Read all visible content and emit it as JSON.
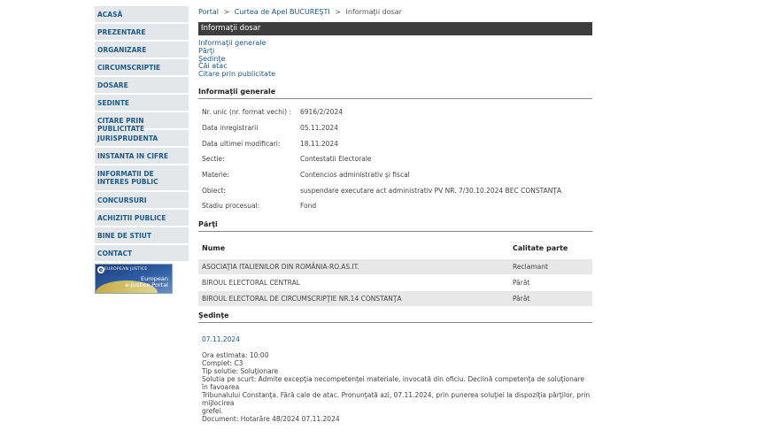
{
  "sidebar": {
    "items": [
      {
        "label": "ACASĂ"
      },
      {
        "label": "PREZENTARE"
      },
      {
        "label": "ORGANIZARE"
      },
      {
        "label": "CIRCUMSCRIPTIE"
      },
      {
        "label": "DOSARE"
      },
      {
        "label": "SEDINTE"
      },
      {
        "label": "CITARE PRIN PUBLICITATE"
      },
      {
        "label": "JURISPRUDENTA"
      },
      {
        "label": "INSTANTA IN CIFRE"
      },
      {
        "label": "INFORMATII DE INTERES PUBLIC"
      },
      {
        "label": "CONCURSURI"
      },
      {
        "label": "ACHIZITII PUBLICE"
      },
      {
        "label": "BINE DE STIUT"
      },
      {
        "label": "CONTACT"
      }
    ],
    "ejustice": {
      "top": "EUROPEAN JUSTICE",
      "line1": "European",
      "line2": "e-Justice Portal"
    }
  },
  "breadcrumb": {
    "portal": "Portal",
    "court": "Curtea de Apel BUCUREŞTI",
    "current": "Informaţii dosar",
    "sep": ">"
  },
  "title": "Informaţii dosar",
  "toc": [
    "Informaţii generale",
    "Părţi",
    "Şedinţe",
    "Căi atac",
    "Citare prin publicitate"
  ],
  "general": {
    "heading": "Informaţii generale",
    "rows": [
      {
        "label": "Nr. unic (nr. format vechi) :",
        "value": "6916/2/2024"
      },
      {
        "label": "Data inregistrarii",
        "value": "05.11.2024"
      },
      {
        "label": "Data ultimei modificari:",
        "value": "18.11.2024"
      },
      {
        "label": "Sectie:",
        "value": "Contestatii Electorale"
      },
      {
        "label": "Materie:",
        "value": "Contencios administrativ şi fiscal"
      },
      {
        "label": "Obiect:",
        "value": "suspendare executare act administrativ PV NR. 7/30.10.2024 BEC CONSTANŢA"
      },
      {
        "label": "Stadiu procesual:",
        "value": "Fond"
      }
    ]
  },
  "parti": {
    "heading": "Părţi",
    "col_name": "Nume",
    "col_calitate": "Calitate parte",
    "rows": [
      {
        "name": "ASOCIAŢIA ITALIENILOR DIN ROMÂNIA-RO.AS.IT.",
        "calitate": "Reclamant"
      },
      {
        "name": "BIROUL ELECTORAL CENTRAL",
        "calitate": "Pârât"
      },
      {
        "name": "BIROUL ELECTORAL DE CIRCUMSCRIPŢIE NR.14 CONSTANŢA",
        "calitate": "Pârât"
      }
    ]
  },
  "sedinte": {
    "heading": "Şedinţe",
    "date": "07.11.2024",
    "lines": [
      "Ora estimata: 10:00",
      "Complet: C3",
      "Tip solutie: Soluţionare",
      "Solutia pe scurt: Admite excepţia necompetenţei materiale, invocată din oficiu. Declină competenţa de soluţionare în favoarea",
      "Tribunalului Constanţa. Fără cale de atac. Pronunţată azi, 07.11.2024, prin punerea soluţiei la dispoziţia părţilor, prin mijlocirea",
      "grefei.",
      "Document: Hotarâre  48/2024  07.11.2024"
    ]
  }
}
